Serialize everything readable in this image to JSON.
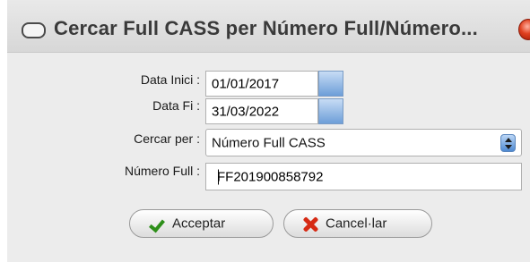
{
  "window": {
    "title": "Cercar Full CASS per Número Full/Número...",
    "icon": "window-icon",
    "close_icon": "close-icon"
  },
  "form": {
    "start_date": {
      "label": "Data Inici :",
      "value": "01/01/2017"
    },
    "end_date": {
      "label": "Data Fi :",
      "value": "31/03/2022"
    },
    "search_by": {
      "label": "Cercar per :",
      "value": "Número Full CASS"
    },
    "sheet_number": {
      "label": "Número Full :",
      "value": "FF201900858792"
    }
  },
  "buttons": {
    "accept": {
      "label": "Acceptar",
      "icon": "checkmark-icon"
    },
    "cancel": {
      "label": "Cancel·lar",
      "icon": "x-icon"
    }
  },
  "colors": {
    "accent": "#6d9ed8",
    "close": "#e0401f",
    "check": "#2e8f1a",
    "cancel": "#d62a14"
  }
}
